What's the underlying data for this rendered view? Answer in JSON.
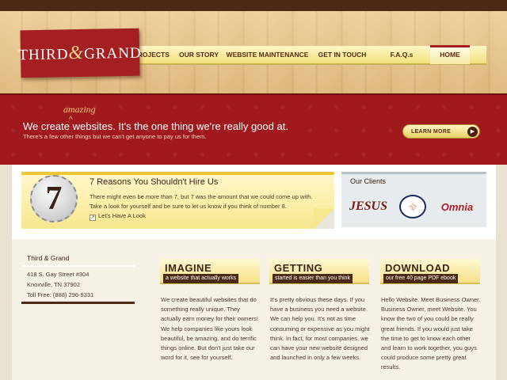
{
  "brand": {
    "logo_left": "THIRD",
    "logo_amp": "&",
    "logo_right": "GRAND"
  },
  "nav": {
    "items": [
      "PROJECTS",
      "OUR STORY",
      "WEBSITE MAINTENANCE",
      "GET IN TOUCH",
      "F.A.Q.s",
      "HOME"
    ],
    "active": "HOME"
  },
  "hero": {
    "insert_word": "amazing",
    "caret": "^",
    "tagline": "We create websites. It's the one thing we're really good at.",
    "subtagline": "There's a few other things but we can't get anyone to pay us for them.",
    "cta_label": "LEARN MORE"
  },
  "reasons": {
    "number": "7",
    "title": "7 Reasons You Shouldn't Hire Us",
    "body": "There might even be more than 7, but 7 was the amount that we could come up with. Take a look for yourself and be sure to let us know if you think of number 8.",
    "link": "Let's Have A Look"
  },
  "clients": {
    "title": "Our Clients",
    "logos": [
      "JESUS",
      "BOSTON RED SOX",
      "Omnia"
    ]
  },
  "address": {
    "name": "Third & Grand",
    "street": "418 S. Gay Street #304",
    "city": "Knoxville, TN 37902",
    "phone": "Toll Free: (888) 296-9331"
  },
  "columns": [
    {
      "heading": "IMAGINE",
      "sub": "a website that actually works",
      "body": "We create beautiful websites that do something really unique. They actually earn money for their owners! We help companies like yours look beautiful, be amazing, and do terrific things online. But don't just take our word for it, see for yourself."
    },
    {
      "heading": "GETTING",
      "sub": "started is easier than you think",
      "body": "It's pretty obvious these days. If you have a business you need a website. We can help you. It's not as time consuming or expensive as you might think. In fact, for most companies, we can have your new website designed and launched in only a few weeks."
    },
    {
      "heading": "DOWNLOAD",
      "sub": "our free 40 page PDF ebook",
      "body": "Hello Website. Meet Business Owner. Business Owner, meet Website. You know the two of you could be really great friends. If you would just take the time to get to know each other and learn to work together, you guys could produce some pretty great results."
    }
  ]
}
